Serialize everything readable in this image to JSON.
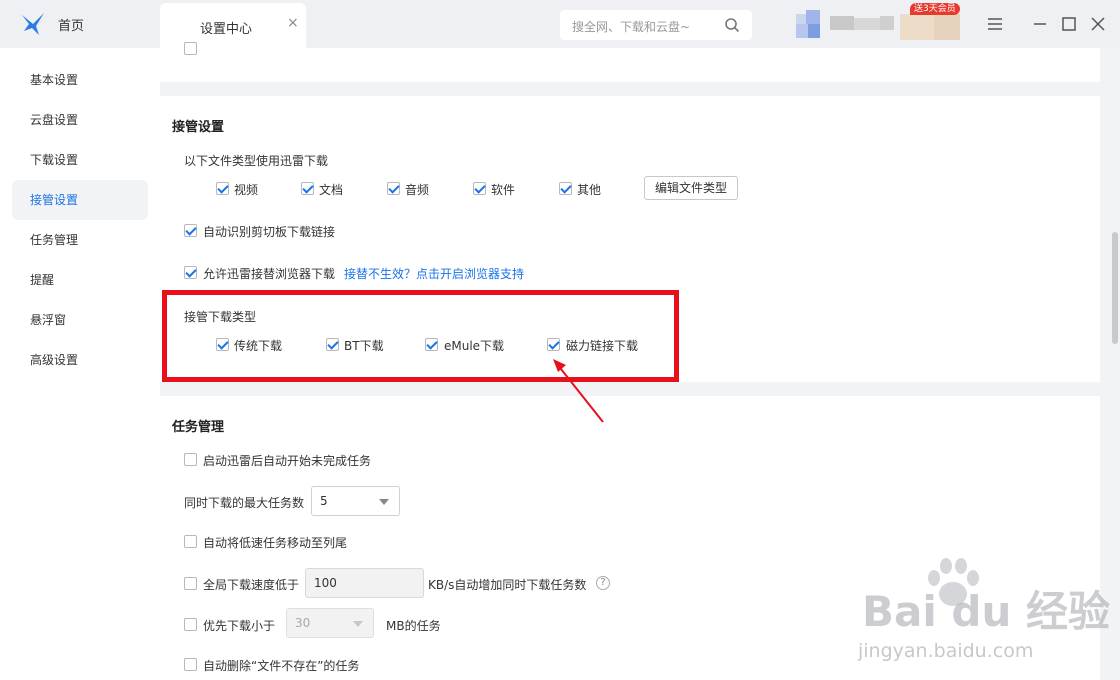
{
  "topbar": {
    "home_label": "首页",
    "tab_title": "设置中心",
    "tab_close": "×",
    "search_placeholder": "搜全网、下载和云盘~",
    "vip_badge": "送3天会员"
  },
  "sidebar": {
    "items": [
      {
        "label": "基本设置"
      },
      {
        "label": "云盘设置"
      },
      {
        "label": "下载设置"
      },
      {
        "label": "接管设置"
      },
      {
        "label": "任务管理"
      },
      {
        "label": "提醒"
      },
      {
        "label": "悬浮窗"
      },
      {
        "label": "高级设置"
      }
    ],
    "active_index": 3
  },
  "takeover": {
    "title": "接管设置",
    "file_types_label": "以下文件类型使用迅雷下载",
    "file_types": [
      {
        "label": "视频",
        "checked": true
      },
      {
        "label": "文档",
        "checked": true
      },
      {
        "label": "音频",
        "checked": true
      },
      {
        "label": "软件",
        "checked": true
      },
      {
        "label": "其他",
        "checked": true
      }
    ],
    "edit_button": "编辑文件类型",
    "clipboard_label": "自动识别剪切板下载链接",
    "browser_label": "允许迅雷接替浏览器下载",
    "browser_link": "接替不生效？点击开启浏览器支持",
    "download_types_label": "接管下载类型",
    "download_types": [
      {
        "label": "传统下载",
        "checked": true
      },
      {
        "label": "BT下载",
        "checked": true
      },
      {
        "label": "eMule下载",
        "checked": true
      },
      {
        "label": "磁力链接下载",
        "checked": true
      }
    ]
  },
  "tasks": {
    "title": "任务管理",
    "auto_start_label": "启动迅雷后自动开始未完成任务",
    "max_tasks_label": "同时下载的最大任务数",
    "max_tasks_value": "5",
    "move_slow_label": "自动将低速任务移动至列尾",
    "speed_label_pre": "全局下载速度低于",
    "speed_value": "100",
    "speed_label_post": "KB/s自动增加同时下载任务数",
    "help_glyph": "?",
    "priority_label_pre": "优先下载小于",
    "priority_value": "30",
    "priority_label_post": "MB的任务",
    "delete_missing_label": "自动删除“文件不存在”的任务"
  },
  "watermark": {
    "brand": "Bai du 经验",
    "url": "jingyan.baidu.com"
  },
  "colors": {
    "accent": "#1a73e8",
    "highlight_box": "#e8101a",
    "arrow": "#e8101a"
  }
}
